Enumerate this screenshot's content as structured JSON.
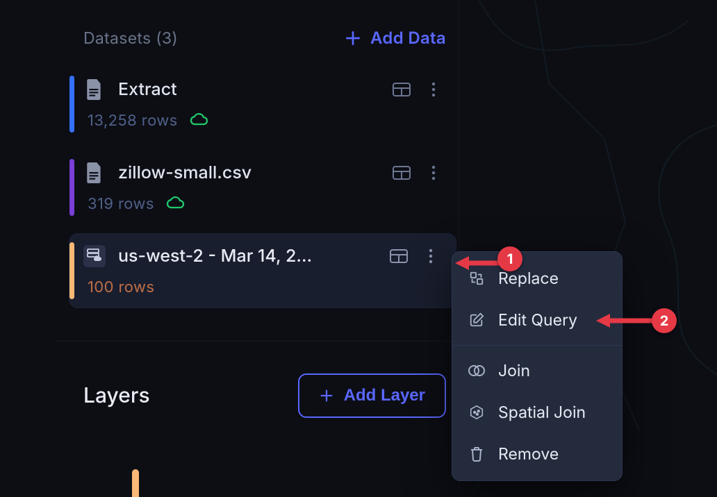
{
  "section": {
    "title": "Datasets (3)"
  },
  "actions": {
    "add_data": "Add Data"
  },
  "datasets": [
    {
      "name": "Extract",
      "rows": "13,258 rows",
      "accent": "blue",
      "cloud": true
    },
    {
      "name": "zillow-small.csv",
      "rows": "319 rows",
      "accent": "purple",
      "cloud": true
    },
    {
      "name": "us-west-2 - Mar 14, 2…",
      "rows": "100 rows",
      "accent": "amber",
      "selected": true
    }
  ],
  "layers": {
    "title": "Layers",
    "add_layer": "Add Layer"
  },
  "menu": {
    "replace": "Replace",
    "edit_query": "Edit Query",
    "join": "Join",
    "spatial_join": "Spatial Join",
    "remove": "Remove"
  },
  "callouts": {
    "one": "1",
    "two": "2"
  }
}
